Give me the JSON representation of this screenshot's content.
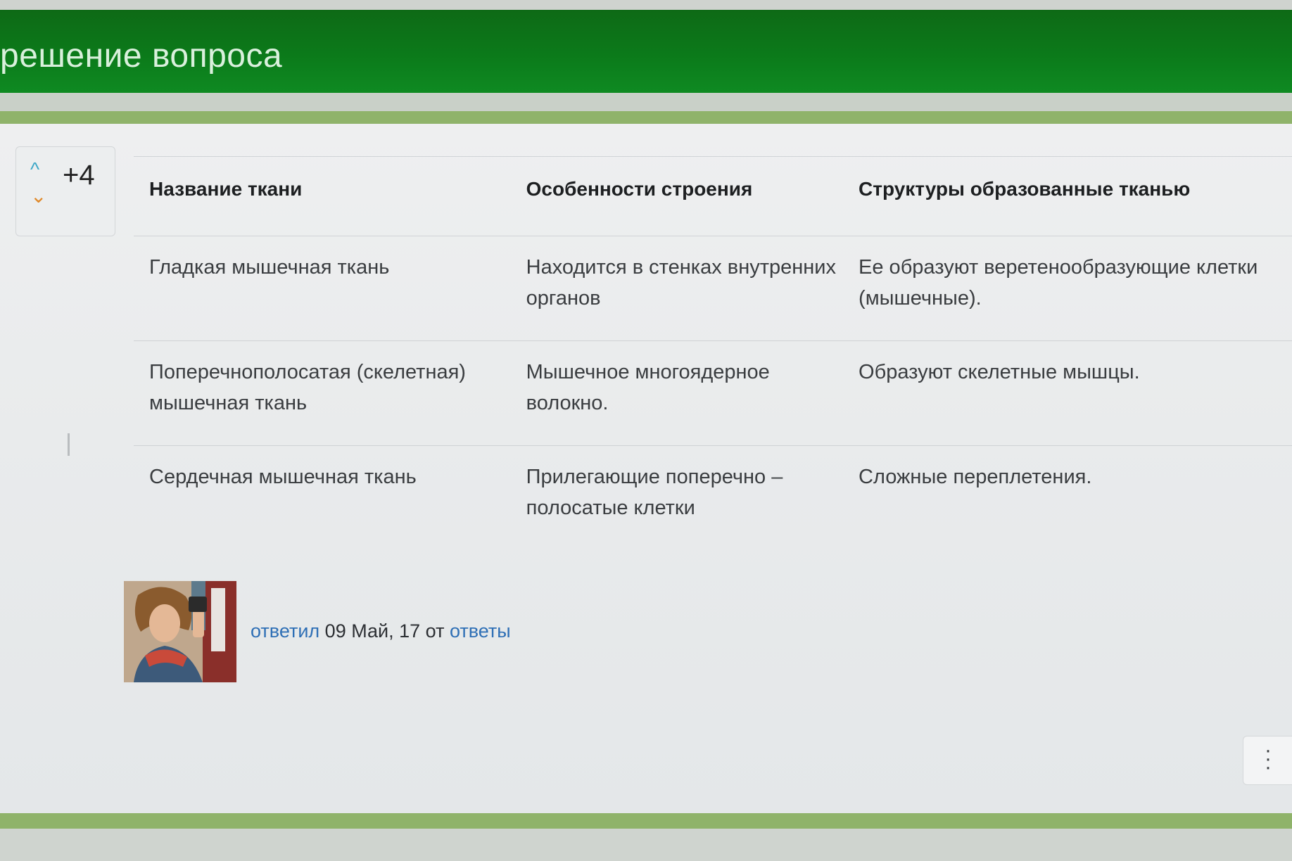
{
  "header": {
    "title": "решение вопроса"
  },
  "vote": {
    "count": "+4",
    "up_glyph": "^",
    "down_glyph": "⌄"
  },
  "table": {
    "headers": [
      "Название ткани",
      "Особенности строения",
      "Структуры образованные тканью"
    ],
    "rows": [
      {
        "name": "Гладкая мышечная ткань",
        "features": "Находится в стенках внутренних органов",
        "structures": "Ее образуют веретенообразующие клетки (мышечные)."
      },
      {
        "name": "Поперечнополосатая (скелетная) мышечная ткань",
        "features": "Мышечное многоядерное волокно.",
        "structures": "Образуют скелетные мышцы."
      },
      {
        "name": "Сердечная мышечная ткань",
        "features": "Прилегающие поперечно – полосатые клетки",
        "structures": "Сложные переплетения."
      }
    ]
  },
  "answer_meta": {
    "answered_label": "ответил",
    "date": "09 Май, 17",
    "from_label": "от",
    "author": "ответы"
  },
  "icons": {
    "menu": "more-vertical-icon",
    "vote_up": "chevron-up-icon",
    "vote_down": "chevron-down-icon"
  },
  "colors": {
    "header_green": "#0b7a1a",
    "accent_border": "#8fb36a",
    "vote_up": "#3da7c7",
    "vote_down": "#e0892a",
    "link": "#2e6fb5"
  }
}
